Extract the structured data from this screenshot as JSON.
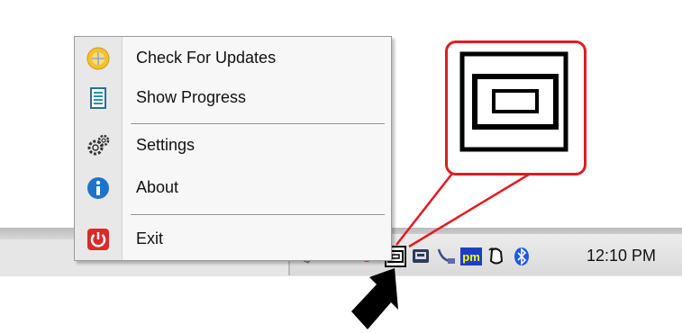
{
  "menu": {
    "items": [
      {
        "label": "Check For Updates",
        "icon": "update-globe-icon"
      },
      {
        "label": "Show Progress",
        "icon": "progress-list-icon"
      },
      {
        "label": "Settings",
        "icon": "gears-icon"
      },
      {
        "label": "About",
        "icon": "info-icon"
      },
      {
        "label": "Exit",
        "icon": "power-icon"
      }
    ]
  },
  "taskbar": {
    "clock": "12:10 PM",
    "tray_icons": [
      "app-tray-icon",
      "network-card-icon",
      "usb-cable-icon",
      "pm-icon",
      "mouse-icon",
      "bluetooth-icon"
    ]
  },
  "callout": {
    "icon": "app-tray-icon-magnified",
    "color": "#e21b22"
  }
}
